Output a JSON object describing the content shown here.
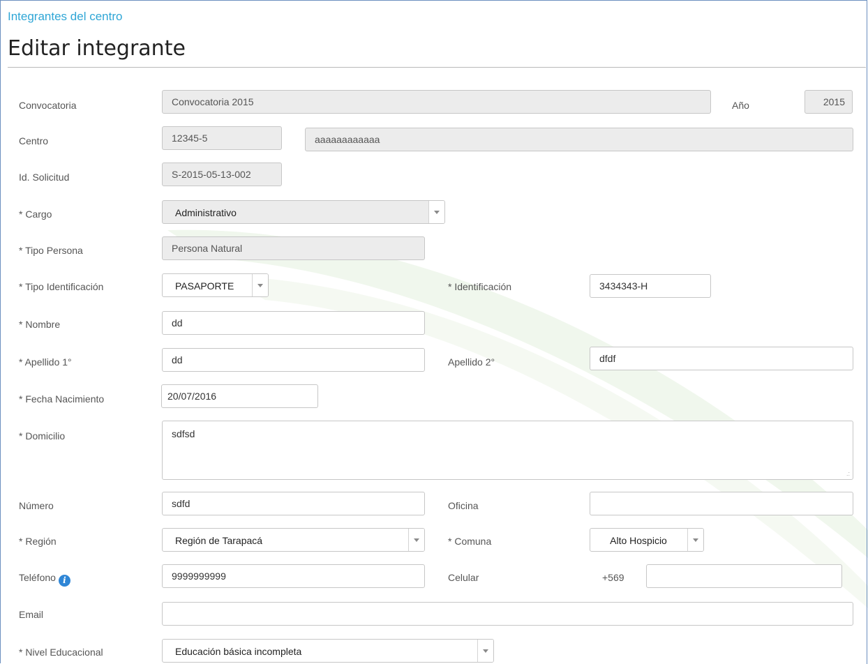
{
  "breadcrumb": "Integrantes del centro",
  "title": "Editar integrante",
  "form": {
    "convocatoria": {
      "label": "Convocatoria",
      "value": "Convocatoria 2015"
    },
    "anio": {
      "label": "Año",
      "value": "2015"
    },
    "centro": {
      "label": "Centro",
      "code": "12345-5",
      "name": "aaaaaaaaaaaa"
    },
    "id_solicitud": {
      "label": "Id. Solicitud",
      "value": "S-2015-05-13-002"
    },
    "cargo": {
      "label": "* Cargo",
      "value": "Administrativo"
    },
    "tipo_persona": {
      "label": "* Tipo Persona",
      "value": "Persona Natural"
    },
    "tipo_identificacion": {
      "label": "* Tipo Identificación",
      "value": "PASAPORTE"
    },
    "identificacion": {
      "label": "* Identificación",
      "value": "3434343-H"
    },
    "nombre": {
      "label": "* Nombre",
      "value": "dd"
    },
    "apellido1": {
      "label": "* Apellido 1°",
      "value": "dd"
    },
    "apellido2": {
      "label": "Apellido 2°",
      "value": "dfdf"
    },
    "fecha_nacimiento": {
      "label": "* Fecha Nacimiento",
      "value": "20/07/2016"
    },
    "domicilio": {
      "label": "* Domicilio",
      "value": "sdfsd"
    },
    "numero": {
      "label": "Número",
      "value": "sdfd"
    },
    "oficina": {
      "label": "Oficina",
      "value": ""
    },
    "region": {
      "label": "* Región",
      "value": "Región de Tarapacá"
    },
    "comuna": {
      "label": "* Comuna",
      "value": "Alto Hospicio"
    },
    "telefono": {
      "label": "Teléfono",
      "value": "9999999999",
      "info_icon": "info-icon"
    },
    "celular": {
      "label": "Celular",
      "prefix": "+569",
      "value": ""
    },
    "email": {
      "label": "Email",
      "value": ""
    },
    "nivel_educacional": {
      "label": "* Nivel Educacional",
      "value": "Educación básica incompleta"
    }
  },
  "colors": {
    "link": "#2fa6d6",
    "border": "#c6c6c6",
    "readonly_bg": "#ececec",
    "info": "#2f86d6"
  }
}
